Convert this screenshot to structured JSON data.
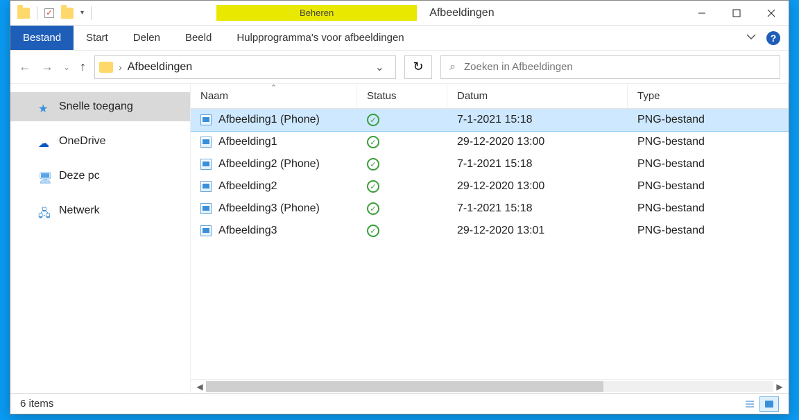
{
  "window": {
    "title": "Afbeeldingen"
  },
  "ribbon": {
    "context_tab": "Beheren",
    "file": "Bestand",
    "tabs": [
      "Start",
      "Delen",
      "Beeld"
    ],
    "context_sub": "Hulpprogramma's voor afbeeldingen"
  },
  "address": {
    "crumb": "Afbeeldingen"
  },
  "search": {
    "placeholder": "Zoeken in Afbeeldingen"
  },
  "sidebar": {
    "items": [
      {
        "label": "Snelle toegang",
        "icon": "star"
      },
      {
        "label": "OneDrive",
        "icon": "cloud"
      },
      {
        "label": "Deze pc",
        "icon": "pc"
      },
      {
        "label": "Netwerk",
        "icon": "net"
      }
    ]
  },
  "columns": {
    "name": "Naam",
    "status": "Status",
    "date": "Datum",
    "type": "Type"
  },
  "files": [
    {
      "name": "Afbeelding1 (Phone)",
      "date": "7-1-2021 15:18",
      "type": "PNG-bestand"
    },
    {
      "name": "Afbeelding1",
      "date": "29-12-2020 13:00",
      "type": "PNG-bestand"
    },
    {
      "name": "Afbeelding2 (Phone)",
      "date": "7-1-2021 15:18",
      "type": "PNG-bestand"
    },
    {
      "name": "Afbeelding2",
      "date": "29-12-2020 13:00",
      "type": "PNG-bestand"
    },
    {
      "name": "Afbeelding3 (Phone)",
      "date": "7-1-2021 15:18",
      "type": "PNG-bestand"
    },
    {
      "name": "Afbeelding3",
      "date": "29-12-2020 13:01",
      "type": "PNG-bestand"
    }
  ],
  "statusbar": {
    "count": "6 items"
  }
}
